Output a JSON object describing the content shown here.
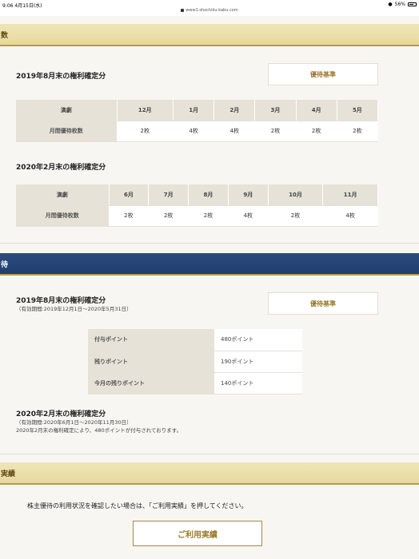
{
  "status": {
    "time": "9:06  4月15日(水)",
    "url": "www1.shochiku-kabu.com",
    "battery": "56%"
  },
  "banners": {
    "tickets": "数",
    "points": "待",
    "usage": "実績"
  },
  "tickets": {
    "criteria_button": "優待基準",
    "block1": {
      "title": "2019年8月末の権利確定分",
      "header": [
        "演劇",
        "12月",
        "1月",
        "2月",
        "3月",
        "4月",
        "5月"
      ],
      "row": [
        "月間優待枚数",
        "2枚",
        "4枚",
        "4枚",
        "2枚",
        "2枚",
        "2枚"
      ]
    },
    "block2": {
      "title": "2020年2月末の権利確定分",
      "header": [
        "演劇",
        "6月",
        "7月",
        "8月",
        "9月",
        "10月",
        "11月"
      ],
      "row": [
        "月間優待枚数",
        "2枚",
        "2枚",
        "2枚",
        "4枚",
        "2枚",
        "4枚"
      ]
    }
  },
  "points": {
    "criteria_button": "優待基準",
    "block1": {
      "title": "2019年8月末の権利確定分",
      "period": "（有効期間:2019年12月1日〜2020年5月31日）",
      "rows": [
        {
          "label": "付与ポイント",
          "value": "480ポイント"
        },
        {
          "label": "残りポイント",
          "value": "190ポイント"
        },
        {
          "label": "今月の残りポイント",
          "value": "140ポイント"
        }
      ]
    },
    "block2": {
      "title": "2020年2月末の権利確定分",
      "period": "（有効期間:2020年6月1日〜2020年11月30日）",
      "note": "2020年2月末の権利確定により、480ポイントが付与されております。"
    }
  },
  "usage": {
    "message": "株主優待の利用状況を確認したい場合は、「ご利用実績」を押してください。",
    "button": "ご利用実績"
  }
}
